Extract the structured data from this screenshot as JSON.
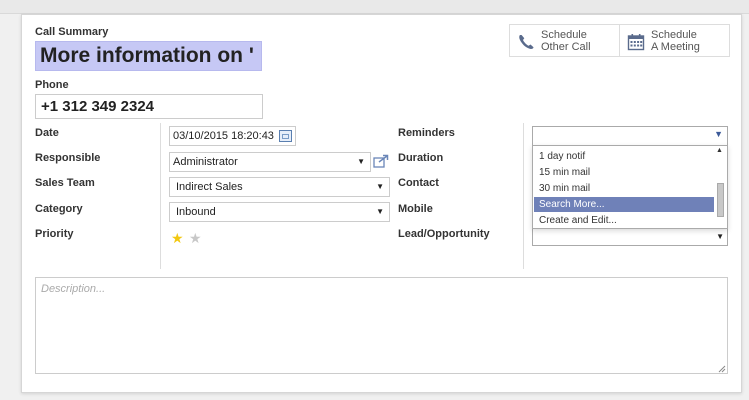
{
  "form": {
    "call_summary_label": "Call Summary",
    "call_summary_value": "More information on '",
    "phone_label": "Phone",
    "phone_value": "+1 312 349 2324"
  },
  "buttons": {
    "schedule_call_line1": "Schedule",
    "schedule_call_line2": "Other Call",
    "schedule_meeting_line1": "Schedule",
    "schedule_meeting_line2": "A Meeting"
  },
  "left_fields": {
    "date_label": "Date",
    "date_value": "03/10/2015 18:20:43",
    "responsible_label": "Responsible",
    "responsible_value": "Administrator",
    "sales_team_label": "Sales Team",
    "sales_team_value": "Indirect Sales",
    "category_label": "Category",
    "category_value": "Inbound",
    "priority_label": "Priority",
    "priority_stars": 1,
    "priority_max": 2
  },
  "right_fields": {
    "reminders_label": "Reminders",
    "duration_label": "Duration",
    "contact_label": "Contact",
    "mobile_label": "Mobile",
    "lead_label": "Lead/Opportunity"
  },
  "reminders_dropdown": {
    "items": [
      "1 day notif",
      "15 min mail",
      "30 min mail",
      "Search More...",
      "Create and Edit..."
    ],
    "selected_index": 3
  },
  "description": {
    "placeholder": "Description..."
  },
  "colors": {
    "title_highlight": "#c6c8f5",
    "selected_item": "#6f81b8",
    "star_active": "#f2c811",
    "star_inactive": "#c8c8c8"
  }
}
